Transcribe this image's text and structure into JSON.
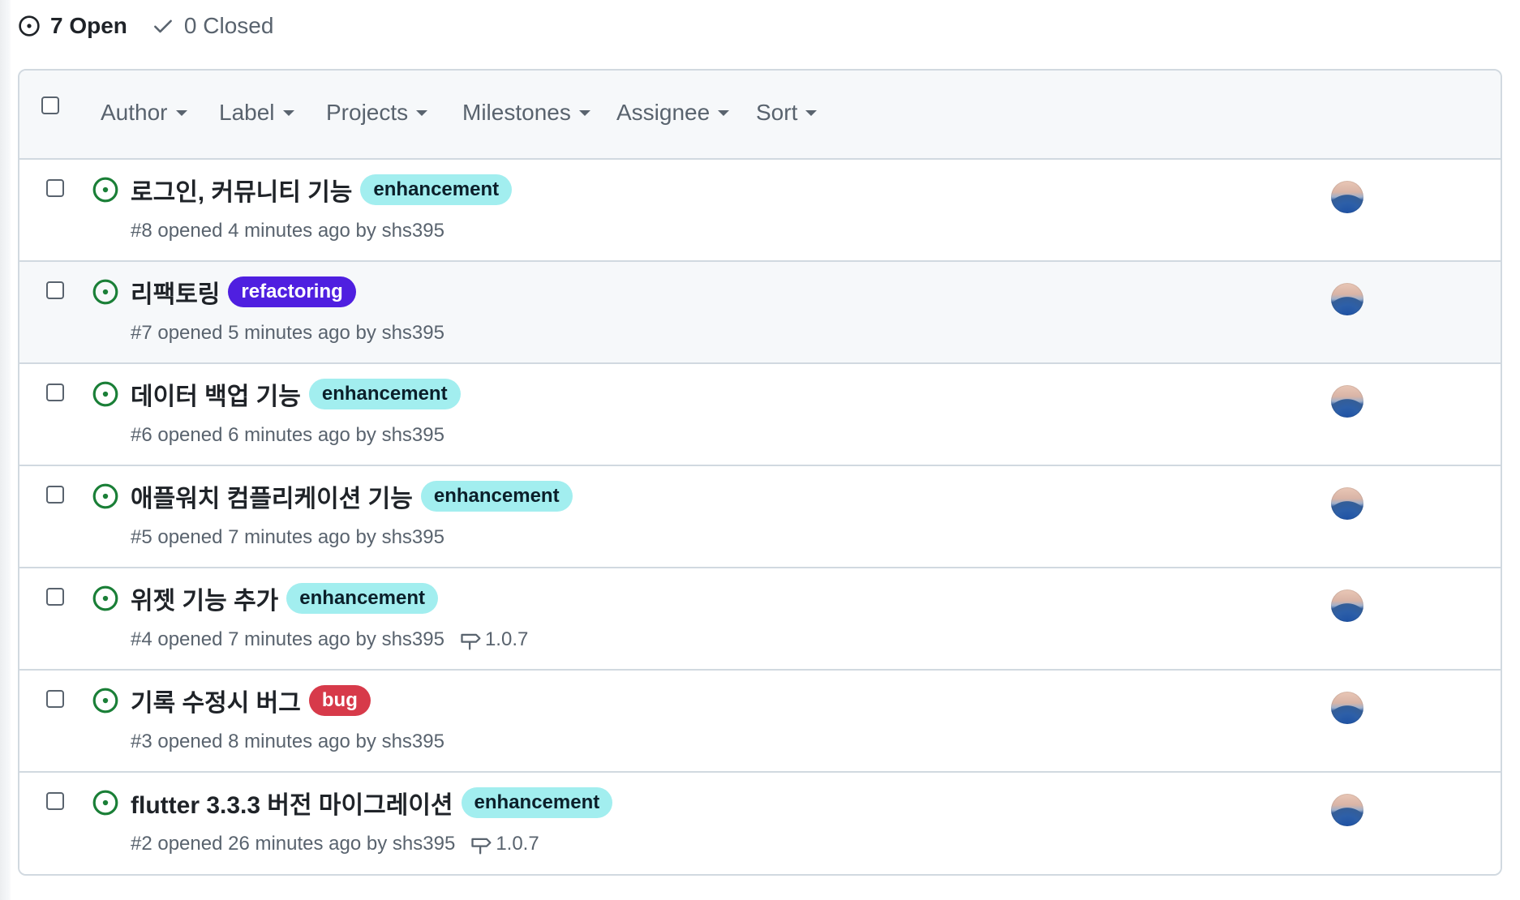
{
  "states": {
    "open_label": "7 Open",
    "closed_label": "0 Closed"
  },
  "filters": [
    "Author",
    "Label",
    "Projects",
    "Milestones",
    "Assignee",
    "Sort"
  ],
  "colors": {
    "open_icon": "#1a7f37",
    "enhancement_bg": "#a2eeef",
    "enhancement_fg": "#0b1f2a",
    "refactoring_bg": "#4f1fe0",
    "refactoring_fg": "#ffffff",
    "bug_bg": "#d73a4a",
    "bug_fg": "#ffffff"
  },
  "issues": [
    {
      "title": "로그인, 커뮤니티 기능",
      "label": "enhancement",
      "meta": "#8 opened 4 minutes ago by shs395",
      "milestone": ""
    },
    {
      "title": "리팩토링",
      "label": "refactoring",
      "meta": "#7 opened 5 minutes ago by shs395",
      "milestone": ""
    },
    {
      "title": "데이터 백업 기능",
      "label": "enhancement",
      "meta": "#6 opened 6 minutes ago by shs395",
      "milestone": ""
    },
    {
      "title": "애플워치 컴플리케이션 기능",
      "label": "enhancement",
      "meta": "#5 opened 7 minutes ago by shs395",
      "milestone": ""
    },
    {
      "title": "위젯 기능 추가",
      "label": "enhancement",
      "meta": "#4 opened 7 minutes ago by shs395",
      "milestone": "1.0.7"
    },
    {
      "title": "기록 수정시 버그",
      "label": "bug",
      "meta": "#3 opened 8 minutes ago by shs395",
      "milestone": ""
    },
    {
      "title": "flutter 3.3.3 버전 마이그레이션",
      "label": "enhancement",
      "meta": "#2 opened 26 minutes ago by shs395",
      "milestone": "1.0.7"
    }
  ]
}
